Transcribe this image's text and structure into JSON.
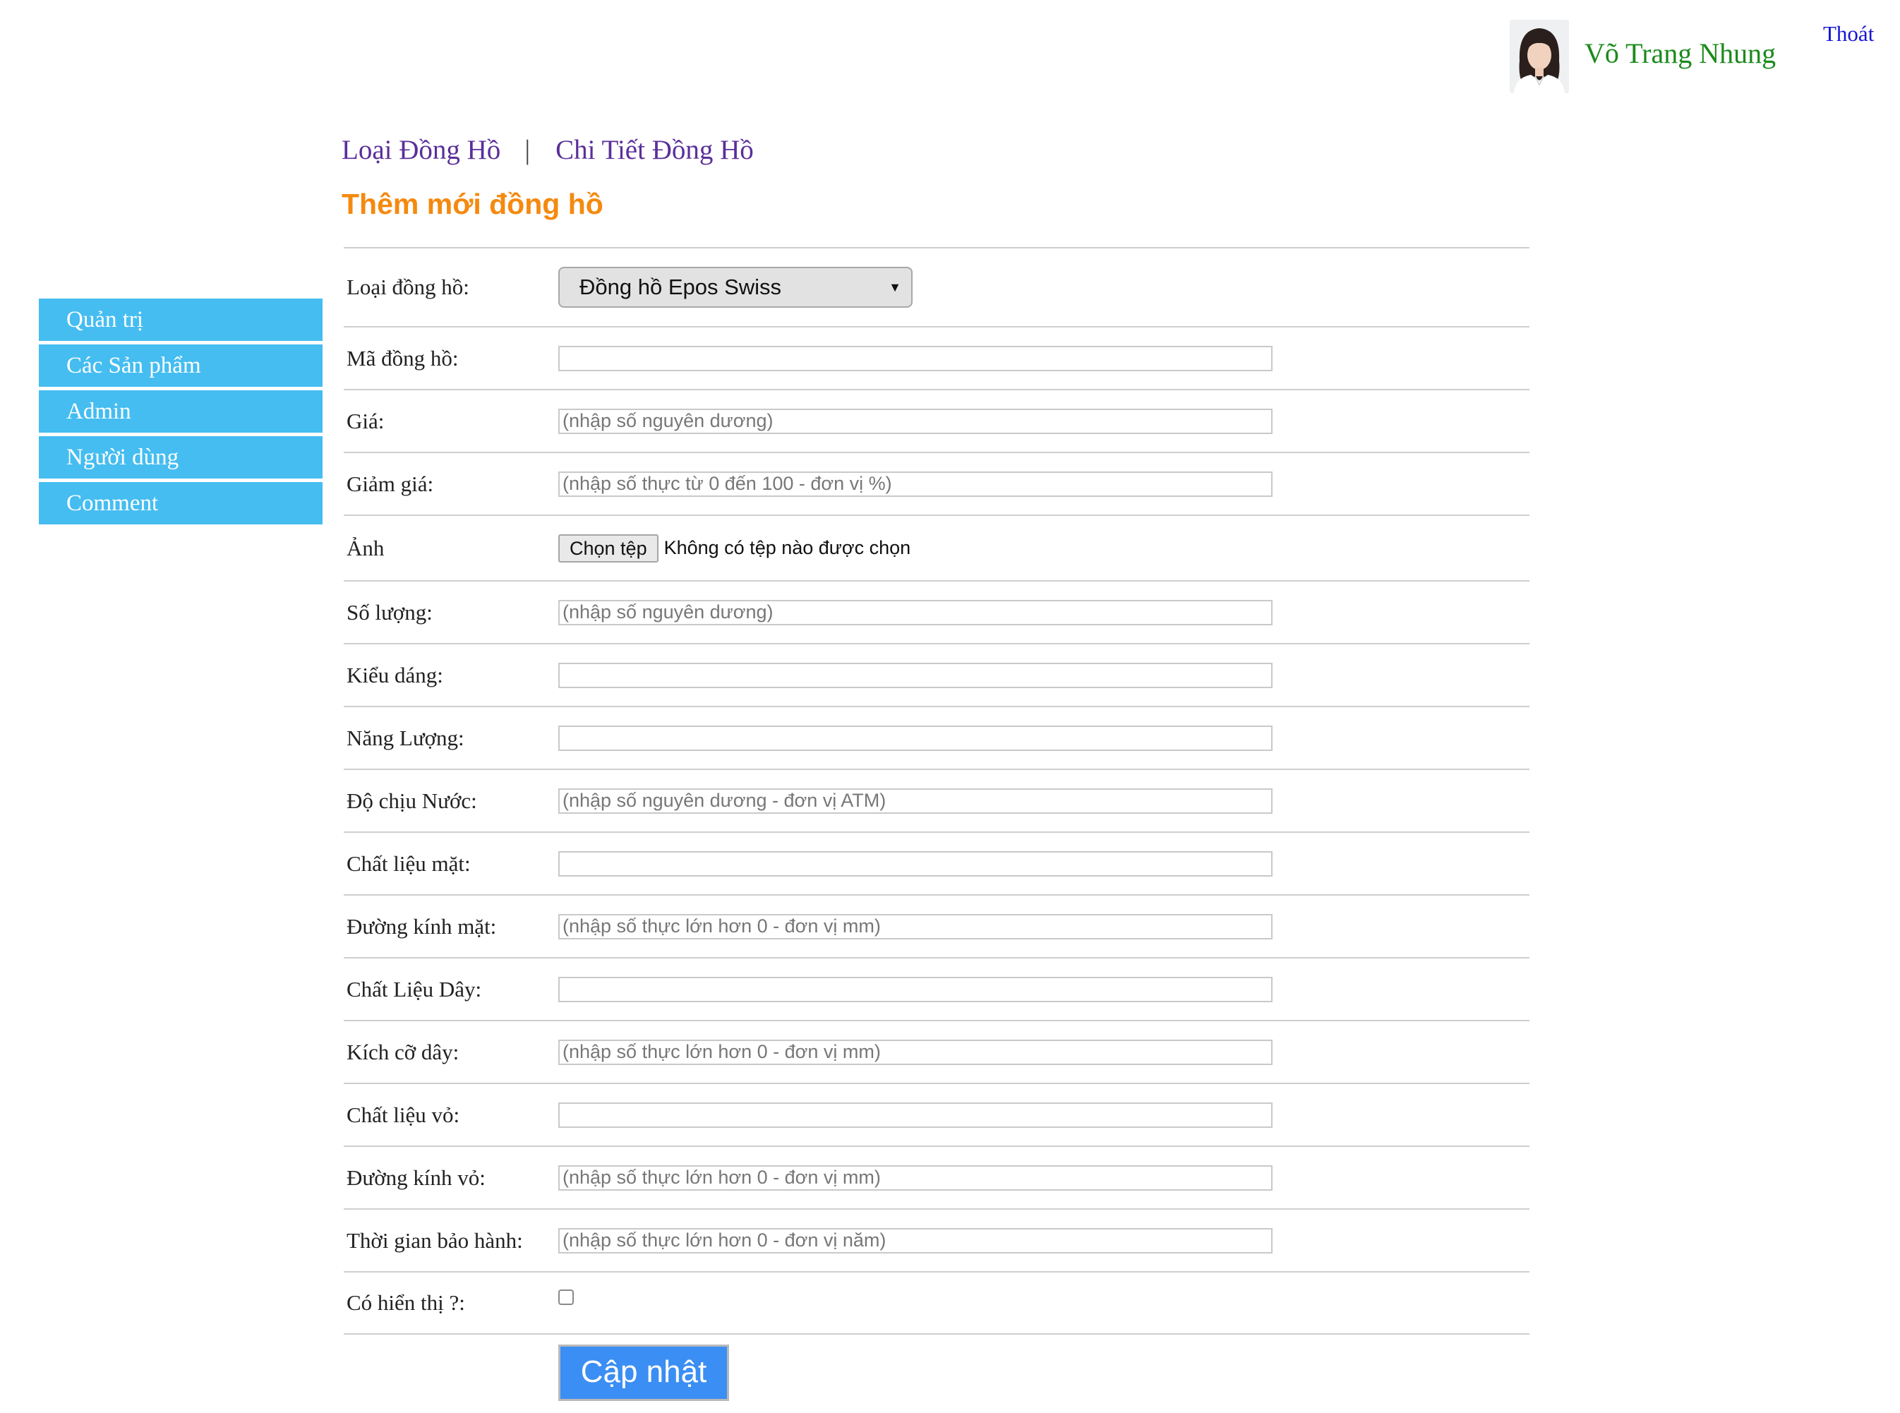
{
  "header": {
    "user_name": "Võ Trang Nhung",
    "logout_label": "Thoát",
    "avatar_icon": "user-photo-icon"
  },
  "sidebar": {
    "items": [
      {
        "label": "Quản trị"
      },
      {
        "label": "Các Sản phẩm"
      },
      {
        "label": "Admin"
      },
      {
        "label": "Người dùng"
      },
      {
        "label": "Comment"
      }
    ]
  },
  "nav": {
    "link1": "Loại Đồng Hồ",
    "separator": "|",
    "link2": "Chi Tiết Đồng Hồ"
  },
  "page_title": "Thêm mới đồng hồ",
  "form": {
    "type_label": "Loại đồng hồ:",
    "type_selected": "Đồng hồ Epos Swiss",
    "code_label": "Mã đồng hồ:",
    "code_placeholder": "",
    "price_label": "Giá:",
    "price_placeholder": "(nhập số nguyên dương)",
    "discount_label": "Giảm giá:",
    "discount_placeholder": "(nhập số thực từ 0 đến 100 - đơn vị %)",
    "image_label": "Ảnh",
    "file_button": "Chọn tệp",
    "file_status": "Không có tệp nào được chọn",
    "quantity_label": "Số lượng:",
    "quantity_placeholder": "(nhập số nguyên dương)",
    "style_label": "Kiểu dáng:",
    "energy_label": "Năng Lượng:",
    "water_label": "Độ chịu Nước:",
    "water_placeholder": "(nhập số nguyên dương - đơn vị ATM)",
    "face_material_label": "Chất liệu mặt:",
    "face_diameter_label": "Đường kính mặt:",
    "face_diameter_placeholder": "(nhập số thực lớn hơn 0 - đơn vị mm)",
    "strap_material_label": "Chất Liệu Dây:",
    "strap_size_label": "Kích cỡ dây:",
    "strap_size_placeholder": "(nhập số thực lớn hơn 0 - đơn vị mm)",
    "case_material_label": "Chất liệu vỏ:",
    "case_diameter_label": "Đường kính vỏ:",
    "case_diameter_placeholder": "(nhập số thực lớn hơn 0 - đơn vị mm)",
    "warranty_label": "Thời gian bảo hành:",
    "warranty_placeholder": "(nhập số thực lớn hơn 0 - đơn vị năm)",
    "display_label": "Có hiển thị ?:",
    "display_checked": false,
    "submit_label": "Cập nhật"
  }
}
